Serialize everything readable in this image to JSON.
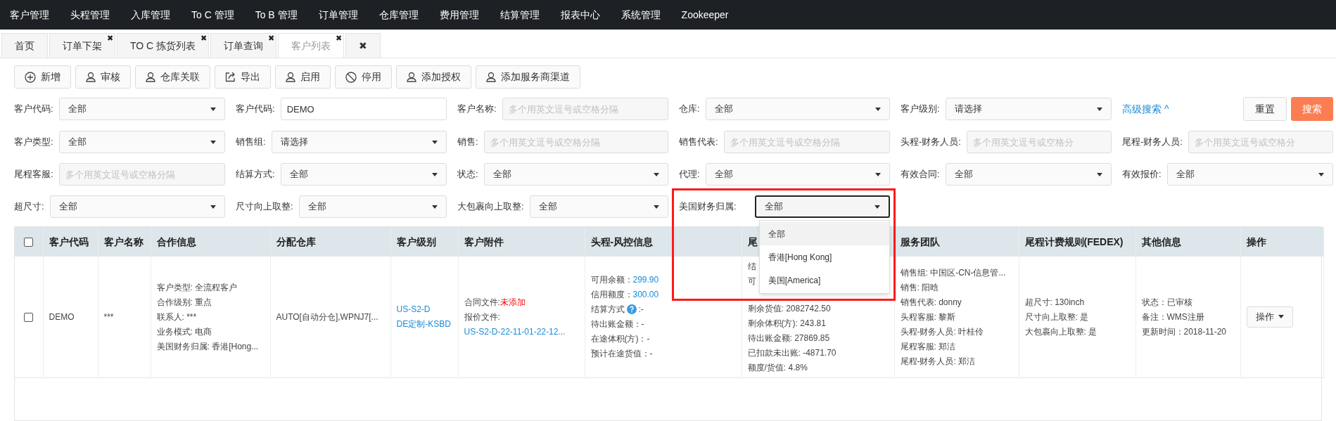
{
  "nav": [
    "客户管理",
    "头程管理",
    "入库管理",
    "To C 管理",
    "To B 管理",
    "订单管理",
    "仓库管理",
    "费用管理",
    "结算管理",
    "报表中心",
    "系统管理",
    "Zookeeper"
  ],
  "tabs": [
    {
      "label": "首页",
      "selected": false
    },
    {
      "label": "订单下架",
      "close": "✖",
      "selected": false
    },
    {
      "label": "TO C 拣货列表",
      "close": "✖",
      "selected": false
    },
    {
      "label": "订单查询",
      "close": "✖",
      "selected": false
    },
    {
      "label": "客户列表",
      "close": "✖",
      "selected": true
    },
    {
      "label": "✖",
      "selected": false
    }
  ],
  "toolbar": [
    {
      "label": "新增",
      "kind": "add"
    },
    {
      "label": "审核",
      "kind": "user"
    },
    {
      "label": "仓库关联",
      "kind": "user"
    },
    {
      "label": "导出",
      "kind": "export"
    },
    {
      "label": "启用",
      "kind": "user"
    },
    {
      "label": "停用",
      "kind": "ban"
    },
    {
      "label": "添加授权",
      "kind": "user"
    },
    {
      "label": "添加服务商渠道",
      "kind": "user"
    }
  ],
  "filters": [
    [
      {
        "label": "客户代码:",
        "kind": "select",
        "value": "全部"
      },
      {
        "label": "客户代码:",
        "kind": "input",
        "value": "DEMO"
      },
      {
        "label": "客户名称:",
        "kind": "input",
        "placeholder": "多个用英文逗号或空格分隔"
      },
      {
        "label": "仓库:",
        "kind": "select",
        "value": "全部"
      },
      {
        "label": "客户级别:",
        "kind": "select",
        "value": "请选择"
      }
    ],
    [
      {
        "label": "客户类型:",
        "kind": "select",
        "value": "全部"
      },
      {
        "label": "销售组:",
        "kind": "select",
        "value": "请选择"
      },
      {
        "label": "销售:",
        "kind": "input",
        "placeholder": "多个用英文逗号或空格分隔"
      },
      {
        "label": "销售代表:",
        "kind": "input",
        "placeholder": "多个用英文逗号或空格分隔"
      },
      {
        "label": "头程-财务人员:",
        "kind": "input",
        "placeholder": "多个用英文逗号或空格分"
      },
      {
        "label": "尾程-财务人员:",
        "kind": "input",
        "placeholder": "多个用英文逗号或空格分"
      }
    ],
    [
      {
        "label": "尾程客服:",
        "kind": "input",
        "placeholder": "多个用英文逗号或空格分隔"
      },
      {
        "label": "结算方式:",
        "kind": "select",
        "value": "全部"
      },
      {
        "label": "状态:",
        "kind": "select",
        "value": "全部"
      },
      {
        "label": "代理:",
        "kind": "select",
        "value": "全部"
      },
      {
        "label": "有效合同:",
        "kind": "select",
        "value": "全部"
      },
      {
        "label": "有效报价:",
        "kind": "select",
        "value": "全部"
      }
    ],
    [
      {
        "label": "超尺寸:",
        "kind": "select",
        "value": "全部"
      },
      {
        "label": "尺寸向上取整:",
        "kind": "select",
        "value": "全部"
      },
      {
        "label": "大包裹向上取整:",
        "kind": "select",
        "value": "全部"
      },
      {
        "label": "美国财务归属:",
        "kind": "select",
        "value": "全部",
        "expanded": true,
        "options": [
          {
            "label": "全部",
            "selected": true
          },
          {
            "label": "香港[Hong Kong]",
            "selected": false
          },
          {
            "label": "美国[America]",
            "selected": false
          }
        ]
      }
    ]
  ],
  "advanced_search": "高级搜索 ^",
  "reset_button": "重置",
  "search_button": "搜索",
  "table": {
    "all_checked": false,
    "columns": [
      "客户代码",
      "客户名称",
      "合作信息",
      "分配仓库",
      "客户级别",
      "客户附件",
      "头程-风控信息",
      "尾",
      "服务团队",
      "尾程计费规则(FEDEX)",
      "其他信息",
      "操作"
    ],
    "rows": [
      {
        "checked": false,
        "cells": [
          [
            {
              "text": "DEMO"
            }
          ],
          [
            {
              "text": "***"
            }
          ],
          [
            {
              "text": "客户类型: 全流程客户"
            },
            {
              "text": "合作级别: 重点"
            },
            {
              "text": "联系人: ***"
            },
            {
              "text": "业务模式: 电商"
            },
            {
              "text": "美国财务归属: 香港[Hong..."
            }
          ],
          [
            {
              "text": "AUTO[自动分仓],WPNJ7[..."
            }
          ],
          [
            {
              "text": "US-S2-D",
              "kind": "link"
            },
            {
              "text": "DE定制-KSBD",
              "kind": "link"
            }
          ],
          [
            {
              "label": "合同文件:",
              "value": "未添加",
              "kind": "danger"
            },
            {
              "text": "报价文件:"
            },
            {
              "text": "US-S2-D-22-11-01-22-12...",
              "kind": "link"
            }
          ],
          [
            {
              "label": "可用余额：",
              "value": "299.90",
              "kind": "link"
            },
            {
              "label": "信用额度：",
              "value": "300.00",
              "kind": "link"
            },
            {
              "label": "结算方式",
              "value": ":-",
              "kind": "help"
            },
            {
              "text": "待出账金额：-"
            },
            {
              "text": "在途体积(方)：-"
            },
            {
              "text": "预计在途货值：-"
            }
          ],
          [
            {
              "text": "结"
            },
            {
              "text": "可"
            },
            {
              "text": "剩余货值: 2082742.50",
              "gapBefore": true
            },
            {
              "text": "剩余体积(方): 243.81"
            },
            {
              "text": "待出账金额: 27869.85"
            },
            {
              "text": "已扣款未出账: -4871.70"
            },
            {
              "text": "额度/货值: 4.8%"
            }
          ],
          [
            {
              "text": "销售组: 中国区-CN-信息管..."
            },
            {
              "text": "销售: 阳晗"
            },
            {
              "text": "销售代表: donny"
            },
            {
              "text": "头程客服: 黎斯"
            },
            {
              "text": "头程-财务人员: 叶桂伶"
            },
            {
              "text": "尾程客服: 郑洁"
            },
            {
              "text": "尾程-财务人员: 郑洁"
            }
          ],
          [
            {
              "text": "超尺寸: 130inch"
            },
            {
              "text": "尺寸向上取整: 是"
            },
            {
              "text": "大包裹向上取整: 是"
            }
          ],
          [
            {
              "text": "状态：已审核"
            },
            {
              "text": "备注：WMS注册"
            },
            {
              "text": "更新时间：2018-11-20"
            }
          ],
          [
            {
              "text": "操作",
              "kind": "menu"
            }
          ]
        ]
      }
    ]
  }
}
